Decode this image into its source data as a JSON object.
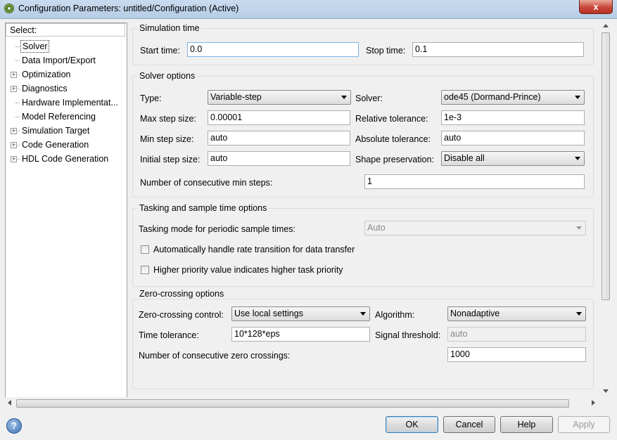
{
  "window": {
    "title": "Configuration Parameters: untitled/Configuration (Active)",
    "close_label": "x"
  },
  "tree": {
    "header": "Select:",
    "items": [
      {
        "label": "Solver",
        "expandable": false
      },
      {
        "label": "Data Import/Export",
        "expandable": false
      },
      {
        "label": "Optimization",
        "expandable": true
      },
      {
        "label": "Diagnostics",
        "expandable": true
      },
      {
        "label": "Hardware Implementat...",
        "expandable": false
      },
      {
        "label": "Model Referencing",
        "expandable": false
      },
      {
        "label": "Simulation Target",
        "expandable": true
      },
      {
        "label": "Code Generation",
        "expandable": true
      },
      {
        "label": "HDL Code Generation",
        "expandable": true
      }
    ],
    "selected": "Solver"
  },
  "simulation_time": {
    "title": "Simulation time",
    "start_label": "Start time:",
    "start_value": "0.0",
    "stop_label": "Stop time:",
    "stop_value": "0.1"
  },
  "solver_options": {
    "title": "Solver options",
    "type_label": "Type:",
    "type_value": "Variable-step",
    "solver_label": "Solver:",
    "solver_value": "ode45 (Dormand-Prince)",
    "max_step_label": "Max step size:",
    "max_step_value": "0.00001",
    "rel_tol_label": "Relative tolerance:",
    "rel_tol_value": "1e-3",
    "min_step_label": "Min step size:",
    "min_step_value": "auto",
    "abs_tol_label": "Absolute tolerance:",
    "abs_tol_value": "auto",
    "init_step_label": "Initial step size:",
    "init_step_value": "auto",
    "shape_label": "Shape preservation:",
    "shape_value": "Disable all",
    "consec_label": "Number of consecutive min steps:",
    "consec_value": "1"
  },
  "tasking": {
    "title": "Tasking and sample time options",
    "mode_label": "Tasking mode for periodic sample times:",
    "mode_value": "Auto",
    "rate_label": "Automatically handle rate transition for data transfer",
    "rate_checked": false,
    "priority_label": "Higher priority value indicates higher task priority",
    "priority_checked": false
  },
  "zero_crossing": {
    "title": "Zero-crossing options",
    "control_label": "Zero-crossing control:",
    "control_value": "Use local settings",
    "algorithm_label": "Algorithm:",
    "algorithm_value": "Nonadaptive",
    "tol_label": "Time tolerance:",
    "tol_value": "10*128*eps",
    "threshold_label": "Signal threshold:",
    "threshold_value": "auto",
    "consec_label": "Number of consecutive zero crossings:",
    "consec_value": "1000"
  },
  "buttons": {
    "ok": "OK",
    "cancel": "Cancel",
    "help": "Help",
    "apply": "Apply"
  },
  "help_icon_label": "?"
}
